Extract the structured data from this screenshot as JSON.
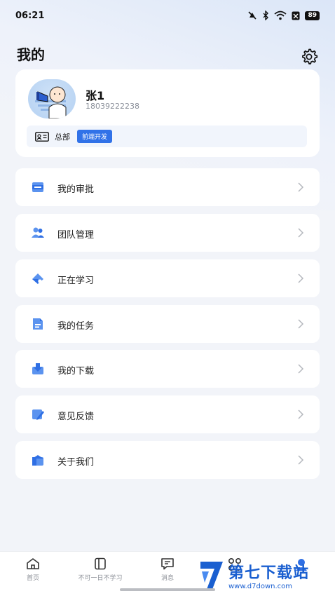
{
  "status_bar": {
    "time": "06:21",
    "battery": "89"
  },
  "header": {
    "title": "我的",
    "settings_icon": "gear-icon"
  },
  "profile": {
    "name": "张1",
    "phone": "18039222238",
    "department": "总部",
    "role_tag": "前端开发"
  },
  "menu": [
    {
      "label": "我的审批",
      "icon": "approval-icon"
    },
    {
      "label": "团队管理",
      "icon": "team-icon"
    },
    {
      "label": "正在学习",
      "icon": "learning-icon"
    },
    {
      "label": "我的任务",
      "icon": "task-icon"
    },
    {
      "label": "我的下载",
      "icon": "download-icon"
    },
    {
      "label": "意见反馈",
      "icon": "feedback-icon"
    },
    {
      "label": "关于我们",
      "icon": "about-icon"
    }
  ],
  "tabs": [
    {
      "label": "首页",
      "icon": "home-icon"
    },
    {
      "label": "不可一日不学习",
      "icon": "book-icon"
    },
    {
      "label": "消息",
      "icon": "message-icon"
    },
    {
      "label": "",
      "icon": "apps-icon"
    },
    {
      "label": "",
      "icon": "profile-icon",
      "active": true
    }
  ],
  "watermark": {
    "title": "第七下载站",
    "url": "www.d7down.com"
  },
  "colors": {
    "accent": "#3172e8",
    "background": "#f2f4f9",
    "card": "#ffffff"
  }
}
